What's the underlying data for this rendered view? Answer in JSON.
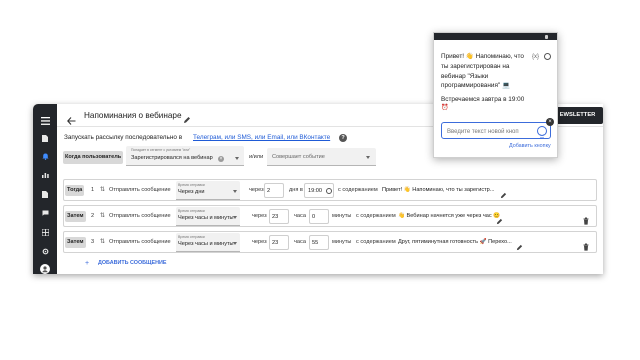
{
  "page": {
    "title": "Напоминания о вебинаре",
    "newsletter_button": "EWSLETTER"
  },
  "intro": {
    "prefix": "Запускать рассылку последовательно в",
    "channels_link": "Телеграм, или SMS, или Email, или ВКонтакте",
    "help": "?"
  },
  "condition": {
    "when_label": "Когда пользователь",
    "trigger_hint": "Попадает в сегмент с условием \"или\"",
    "trigger_value": "Зарегистрировался на вебинар",
    "or_label": "и/или",
    "event_placeholder": "Совершает событие"
  },
  "messages": [
    {
      "badge": "Тогда",
      "num": "1",
      "action": "Отправлять сообщение",
      "time_hint": "Время отправки",
      "time_value": "Через дни",
      "through": "через",
      "amount": "2",
      "unit": "дня в",
      "at_time": "19:00",
      "content_label": "с содержанием",
      "content": "Привет! 👋 Напоминаю, что ты зарегистр...",
      "deletable": false
    },
    {
      "badge": "Затем",
      "num": "2",
      "action": "Отправлять сообщение",
      "time_hint": "Время отправки",
      "time_value": "Через часы и минуты",
      "through": "через",
      "amount": "23",
      "unit": "часа",
      "minutes": "0",
      "minutes_label": "минуты",
      "content_label": "с содержанием",
      "content": "👋 Вебинар начнется уже через час 😊",
      "deletable": true
    },
    {
      "badge": "Затем",
      "num": "3",
      "action": "Отправлять сообщение",
      "time_hint": "Время отправки",
      "time_value": "Через часы и минуты",
      "through": "через",
      "amount": "23",
      "unit": "часа",
      "minutes": "55",
      "minutes_label": "минуты",
      "content_label": "с содержанием",
      "content": "Друг, пятиминутная готовность 🚀 Перехо...",
      "deletable": true
    }
  ],
  "add_message": "ДОБАВИТЬ СООБЩЕНИЕ",
  "popup": {
    "lines": [
      "Привет! 👋 Напоминаю, что",
      "ты зарегистрирован на",
      "вебинар \"Языки",
      "программирования\" 💻"
    ],
    "variable_hint": "{x}",
    "line2": "Встречаемся завтра в 19:00",
    "alarm": "⏰",
    "input_placeholder": "Введите текст новой кноп",
    "add_button": "Добавить кнопку"
  },
  "colors": {
    "rail": "#23262b",
    "link": "#1f5bd6",
    "accent": "#3c6cdb",
    "newsletter_bg": "#23262b"
  },
  "icons": [
    "menu-icon",
    "file-icon",
    "bell-icon",
    "chart-icon",
    "chat-icon",
    "grid-icon",
    "settings-icon",
    "avatar-icon"
  ]
}
